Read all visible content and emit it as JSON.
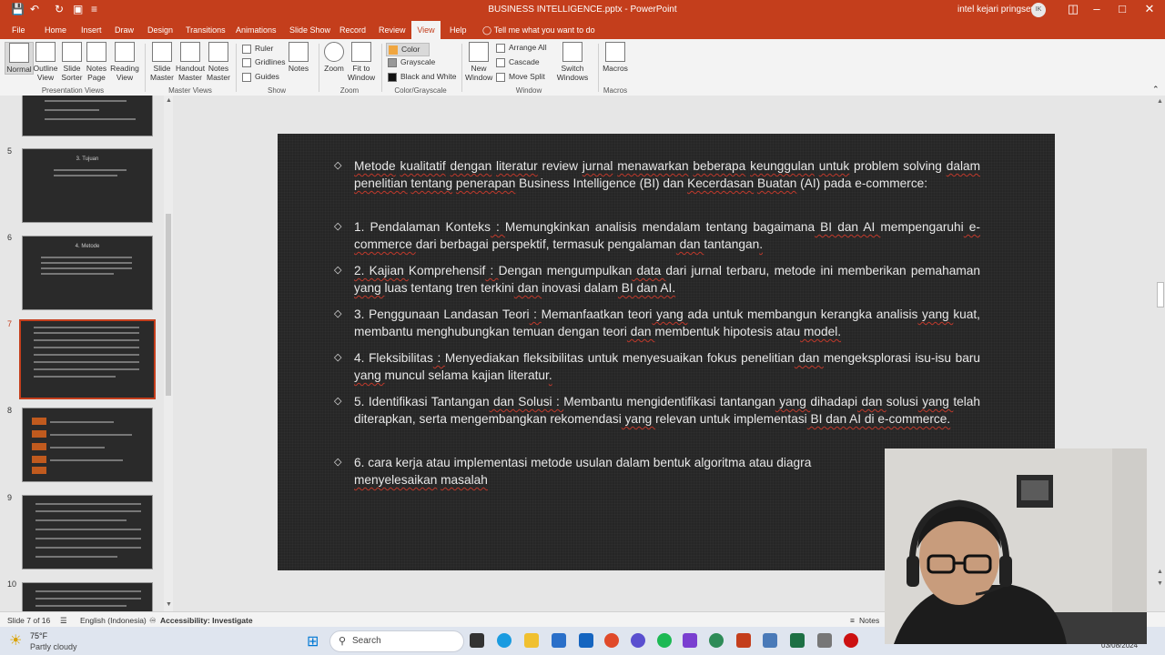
{
  "app": {
    "doc_title": "BUSINESS INTELLIGENCE.pptx  -  PowerPoint",
    "user_name": "intel kejari pringsewu",
    "user_initials": "IK"
  },
  "tabs": [
    "File",
    "Home",
    "Insert",
    "Draw",
    "Design",
    "Transitions",
    "Animations",
    "Slide Show",
    "Record",
    "Review",
    "View",
    "Help"
  ],
  "tell_me": "Tell me what you want to do",
  "ribbon": {
    "presentation_views": [
      "Normal",
      "Outline View",
      "Slide Sorter",
      "Notes Page",
      "Reading View"
    ],
    "master_views": [
      "Slide Master",
      "Handout Master",
      "Notes Master"
    ],
    "show": {
      "ruler": "Ruler",
      "gridlines": "Gridlines",
      "guides": "Guides",
      "notes": "Notes"
    },
    "zoom": {
      "zoom": "Zoom",
      "fit": "Fit to Window"
    },
    "color": [
      "Color",
      "Grayscale",
      "Black and White"
    ],
    "window": {
      "new": "New Window",
      "arrange": "Arrange All",
      "cascade": "Cascade",
      "move_split": "Move Split",
      "switch": "Switch Windows"
    },
    "macros": "Macros",
    "groups": [
      "Presentation Views",
      "Master Views",
      "Show",
      "Zoom",
      "Color/Grayscale",
      "Window",
      "Macros"
    ]
  },
  "thumbnails": {
    "numbers": [
      "5",
      "6",
      "7",
      "8",
      "9",
      "10"
    ],
    "titles": [
      "3. Tujuan",
      "4. Metode"
    ]
  },
  "slide": {
    "bullets": [
      [
        "Metode",
        " ",
        "kualitatif",
        " ",
        "dengan",
        " ",
        "literatur",
        " review ",
        "jurnal",
        " ",
        "menawarkan",
        " ",
        "beberapa",
        " ",
        "keunggulan",
        " ",
        "untuk",
        " problem solving ",
        "dalam",
        " ",
        "penelitian",
        " ",
        "tentang",
        " ",
        "penerapan",
        " Business Intelligence (BI) dan ",
        "Kecerdasan",
        " ",
        "Buatan",
        " (AI) pada e-commerce:"
      ],
      [
        "1. ",
        "Pendalaman",
        " ",
        "Konteks",
        " : ",
        "Memungkinkan",
        " ",
        "analisis",
        " ",
        "mendalam",
        " ",
        "tentang",
        " ",
        "bagaimana",
        " BI dan AI ",
        "mempengaruhi",
        " e-commerce ",
        "dari",
        " ",
        "berbagai",
        " ",
        "perspektif,",
        " ",
        "termasuk",
        " ",
        "pengalaman",
        " dan ",
        "tantangan",
        "."
      ],
      [
        "2. Kajian ",
        "Komprehensif",
        " : ",
        "Dengan",
        " ",
        "mengumpulkan",
        " data ",
        "dari",
        " ",
        "jurnal",
        " ",
        "terbaru,",
        " ",
        "metode",
        " ",
        "ini",
        " ",
        "memberikan",
        " ",
        "pemahaman",
        " yang ",
        "luas",
        " ",
        "tentang",
        " ",
        "tren",
        " ",
        "terkini",
        " dan ",
        "inovasi",
        " ",
        "dalam",
        " BI dan AI."
      ],
      [
        "3. ",
        "Penggunaan",
        " ",
        "Landasan",
        " ",
        "Teori",
        " : ",
        "Memanfaatkan",
        " ",
        "teori",
        " yang ",
        "ada",
        " ",
        "untuk",
        " ",
        "membangun",
        " ",
        "kerangka",
        " ",
        "analisis",
        " yang ",
        "kuat,",
        " ",
        "membantu",
        " ",
        "menghubungkan",
        " ",
        "temuan",
        " ",
        "dengan",
        " ",
        "teori",
        " dan ",
        "membentuk",
        " ",
        "hipotesis",
        " ",
        "atau",
        " model."
      ],
      [
        "4. ",
        "Fleksibilitas",
        " : ",
        "Menyediakan",
        " ",
        "fleksibilitas",
        " ",
        "untuk",
        " ",
        "menyesuaikan",
        " ",
        "fokus",
        " ",
        "penelitian",
        " dan ",
        "mengeksplorasi",
        " ",
        "isu-isu",
        " ",
        "baru",
        " yang ",
        "muncul",
        " ",
        "selama",
        " ",
        "kajian",
        " ",
        "literatur",
        "."
      ],
      [
        "5. ",
        "Identifikasi",
        " ",
        "Tantangan",
        " dan Solusi : ",
        "Membantu",
        " ",
        "mengidentifikasi",
        " ",
        "tantangan",
        " yang ",
        "dihadapi",
        " dan ",
        "solusi",
        " yang ",
        "telah",
        " ",
        "diterapkan,",
        " ",
        "serta",
        " ",
        "mengembangkan",
        " ",
        "rekomendasi",
        " yang ",
        "relevan",
        " ",
        "untuk",
        " ",
        "implementasi",
        " BI dan AI di e-commerce."
      ],
      [
        "6. ",
        "cara",
        " ",
        "kerja",
        " ",
        "atau",
        " ",
        "implementasi",
        " ",
        "metode",
        " ",
        "usulan",
        " ",
        "dalam",
        " ",
        "bentuk",
        " ",
        "algoritma",
        " ",
        "atau",
        " ",
        "diagra",
        "",
        "\n",
        "menyelesaikan",
        " ",
        "masalah"
      ]
    ]
  },
  "status": {
    "slide": "Slide 7 of 16",
    "language": "English (Indonesia)",
    "accessibility": "Accessibility: Investigate",
    "notes": "Notes"
  },
  "taskbar": {
    "temp": "75°F",
    "weather": "Partly cloudy",
    "search": "Search",
    "date": "03/08/2024"
  },
  "colors": {
    "accent": "#c43e1c",
    "slide_bg": "#262626"
  }
}
